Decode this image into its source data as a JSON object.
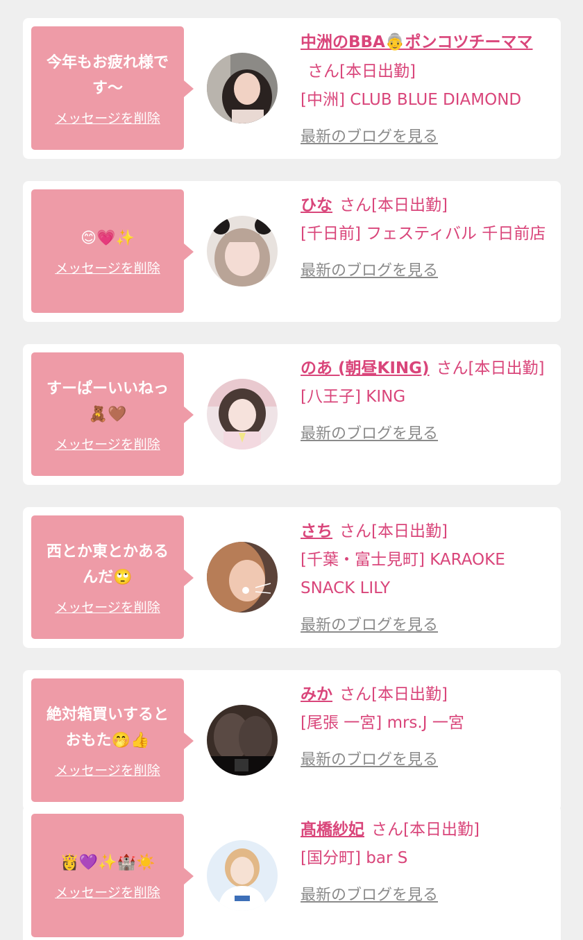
{
  "colors": {
    "background": "#efefef",
    "card": "#ffffff",
    "bubble": "#ee9ba7",
    "accent": "#d9457a",
    "link_gray": "#8a8a8a"
  },
  "cards": [
    {
      "message": "今年もお疲れ様です〜",
      "delete_label": "メッセージを削除",
      "name": "中洲のBBA👵ポンコツチーママ",
      "suffix": "さん[本日出勤]",
      "shop": "[中洲] CLUB BLUE DIAMOND",
      "blog_label": "最新のブログを見る"
    },
    {
      "message": "😊💗✨",
      "delete_label": "メッセージを削除",
      "name": "ひな",
      "suffix": "さん[本日出勤]",
      "shop": "[千日前] フェスティバル 千日前店",
      "blog_label": "最新のブログを見る"
    },
    {
      "message": "すーぱーいいねっ🧸🤎",
      "delete_label": "メッセージを削除",
      "name": "のあ (朝昼KING)",
      "suffix": "さん[本日出勤]",
      "shop": "[八王子] KING",
      "blog_label": "最新のブログを見る"
    },
    {
      "message": "西とか東とかあるんだ🙄",
      "delete_label": "メッセージを削除",
      "name": "さち",
      "suffix": "さん[本日出勤]",
      "shop": "[千葉・富士見町] KARAOKE SNACK LILY",
      "blog_label": "最新のブログを見る"
    },
    {
      "message": "絶対箱買いするとおもた🤭👍",
      "delete_label": "メッセージを削除",
      "name": "みか",
      "suffix": "さん[本日出勤]",
      "shop": "[尾張 一宮] mrs.J 一宮",
      "blog_label": "最新のブログを見る"
    },
    {
      "message": "👸💜✨🏰☀️",
      "delete_label": "メッセージを削除",
      "name": "髙橋紗妃",
      "suffix": "さん[本日出勤]",
      "shop": "[国分町] bar S",
      "blog_label": "最新のブログを見る"
    }
  ]
}
